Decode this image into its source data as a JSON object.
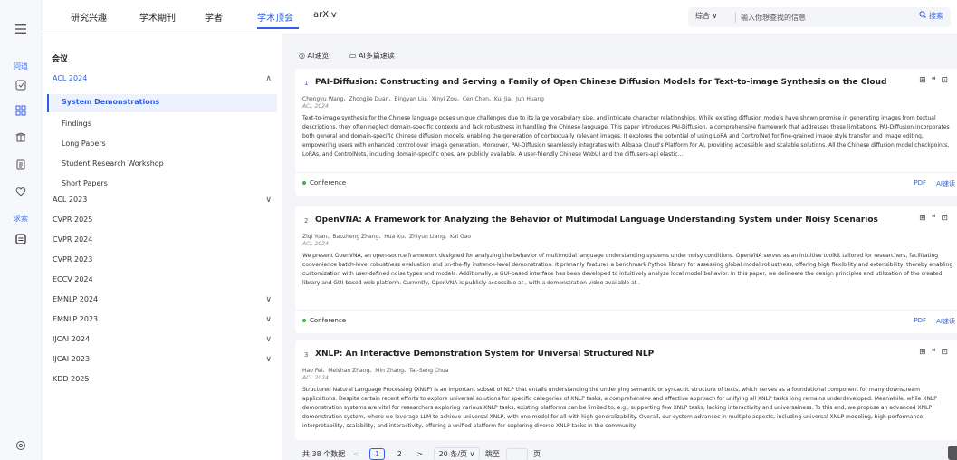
{
  "rail": {
    "items": [
      {
        "icon": "menu-icon"
      },
      {
        "label": "问道"
      },
      {
        "icon": "bookmark-icon"
      },
      {
        "icon": "grid-icon"
      },
      {
        "icon": "library-icon"
      },
      {
        "icon": "document-icon"
      },
      {
        "icon": "heart-icon"
      },
      {
        "label": "求索"
      },
      {
        "icon": "chat-icon"
      },
      {
        "icon": "settings-icon"
      }
    ]
  },
  "tabs": [
    "研究兴趣",
    "学术期刊",
    "学者",
    "学术顶会",
    "arXiv"
  ],
  "active_tab": "学术顶会",
  "search": {
    "scope": "综合 ∨",
    "placeholder": "输入你想查找的信息",
    "button": "搜索"
  },
  "conferences": {
    "title": "会议",
    "groups": [
      {
        "name": "ACL 2024",
        "expanded": true,
        "children": [
          "System Demonstrations",
          "Findings",
          "Long Papers",
          "Student Research Workshop",
          "Short Papers"
        ]
      },
      {
        "name": "ACL 2023",
        "chev": "∨"
      },
      {
        "name": "CVPR 2025"
      },
      {
        "name": "CVPR 2024"
      },
      {
        "name": "CVPR 2023"
      },
      {
        "name": "ECCV 2024"
      },
      {
        "name": "EMNLP 2024",
        "chev": "∨"
      },
      {
        "name": "EMNLP 2023",
        "chev": "∨"
      },
      {
        "name": "IJCAI 2024",
        "chev": "∨"
      },
      {
        "name": "IJCAI 2023",
        "chev": "∨"
      },
      {
        "name": "KDD 2025"
      }
    ],
    "active_child": "System Demonstrations"
  },
  "tools": {
    "ai_browse": "AI速览",
    "ai_multi": "AI多篇速读"
  },
  "papers": [
    {
      "num": "1",
      "title": "PAI-Diffusion: Constructing and Serving a Family of Open Chinese Diffusion Models for Text-to-image Synthesis on the Cloud",
      "authors": "Chengyu Wang、Zhongjie Duan、Bingyan Liu、Xinyi Zou、Cen Chen、Kui Jia、Jun Huang",
      "venue": "ACL 2024",
      "abstract": "Text-to-image synthesis for the Chinese language poses unique challenges due to its large vocabulary size, and intricate character relationships. While existing diffusion models have shown promise in generating images from textual descriptions, they often neglect domain-specific contexts and lack robustness in handling the Chinese language. This paper introduces PAI-Diffusion, a comprehensive framework that addresses these limitations. PAI-Diffusion incorporates both general and domain-specific Chinese diffusion models, enabling the generation of contextually relevant images. It explores the potential of using LoRA and ControlNet for fine-grained image style transfer and image editing, empowering users with enhanced control over image generation. Moreover, PAI-Diffusion seamlessly integrates with Alibaba Cloud's Platform for AI, providing accessible and scalable solutions. All the Chinese diffusion model checkpoints, LoRAs, and ControlNets, including domain-specific ones, are publicly available. A user-friendly Chinese WebUI and the diffusers-api elastic...",
      "tag": "Conference",
      "pdf": "PDF",
      "ai": "AI速读"
    },
    {
      "num": "2",
      "title": "OpenVNA: A Framework for Analyzing the Behavior of Multimodal Language Understanding System under Noisy Scenarios",
      "authors": "Ziqi Yuan、Baozheng Zhang、Hua Xu、Zhiyun Liang、Kai Gao",
      "venue": "ACL 2024",
      "abstract": "We present OpenVNA, an open-source framework designed for analyzing the behavior of multimodal language understanding systems under noisy conditions. OpenVNA serves as an intuitive toolkit tailored for researchers, facilitating convenience batch-level robustness evaluation and on-the-fly instance-level demonstration. It primarily features a benchmark Python library for assessing global model robustness, offering high flexibility and extensibility, thereby enabling customization with user-defined noise types and models. Additionally, a GUI-based interface has been developed to intuitively analyze local model behavior. In this paper, we delineate the design principles and utilization of the created library and GUI-based web platform. Currently, OpenVNA is publicly accessible at , with a demonstration video available at .",
      "tag": "Conference",
      "pdf": "PDF",
      "ai": "AI速读"
    },
    {
      "num": "3",
      "title": "XNLP: An Interactive Demonstration System for Universal Structured NLP",
      "authors": "Hao Fei、Meishan Zhang、Min Zhang、Tat-Seng Chua",
      "venue": "ACL 2024",
      "abstract": "Structured Natural Language Processing (XNLP) is an important subset of NLP that entails understanding the underlying semantic or syntactic structure of texts, which serves as a foundational component for many downstream applications. Despite certain recent efforts to explore universal solutions for specific categories of XNLP tasks, a comprehensive and effective approach for unifying all XNLP tasks long remains underdeveloped. Meanwhile, while XNLP demonstration systems are vital for researchers exploring various XNLP tasks, existing platforms can be limited to, e.g., supporting few XNLP tasks, lacking interactivity and universalness. To this end, we propose an advanced XNLP demonstration system, where we leverage LLM to achieve universal XNLP, with one model for all with high generalizability. Overall, our system advances in multiple aspects, including universal XNLP modeling, high performance, interpretability, scalability, and interactivity, offering a unified platform for exploring diverse XNLP tasks in the community."
    }
  ],
  "pager": {
    "total": "共 38 个数据",
    "prev": "<",
    "pages": [
      "1",
      "2"
    ],
    "next": ">",
    "size": "20 条/页 ∨",
    "jump": "跳至",
    "page_unit": "页"
  }
}
